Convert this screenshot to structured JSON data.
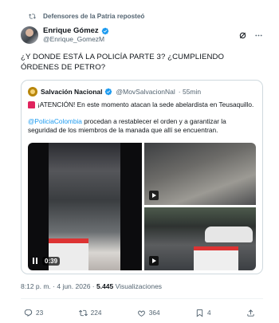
{
  "repost": {
    "text": "Defensores de la Patria reposteó"
  },
  "author": {
    "name": "Enrique Gómez",
    "handle": "@Enrique_GomezM"
  },
  "tweet": {
    "text": "¿Y DONDE ESTÁ LA POLICÍA PARTE 3? ¿CUMPLIENDO ÓRDENES DE PETRO?"
  },
  "quote": {
    "name": "Salvación Nacional",
    "handle": "@MovSalvacionNal",
    "time": "· 55min",
    "alert": "¡ATENCIÓN! En este momento atacan la sede abelardista en Teusaquillo.",
    "mention": "@PoliciaColombia",
    "body": " procedan a restablecer el orden y a garantizar la seguridad de los miembros de la manada que allí se encuentran."
  },
  "video": {
    "duration": "0:39"
  },
  "meta": {
    "timestamp": "8:12 p. m. · 4 jun. 2026 · ",
    "views_count": "5.445",
    "views_label": " Visualizaciones"
  },
  "actions": {
    "replies": "23",
    "reposts": "224",
    "likes": "364",
    "bookmarks": "4"
  },
  "colors": {
    "accent": "#1d9bf0",
    "text": "#0f1419",
    "muted": "#536471"
  }
}
